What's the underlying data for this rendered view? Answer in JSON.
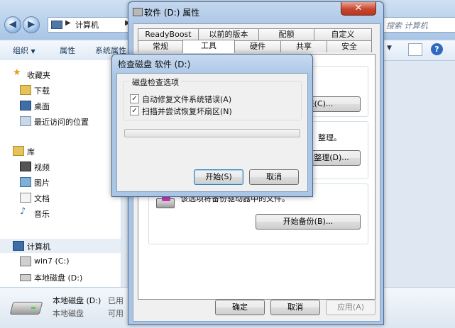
{
  "explorer": {
    "address_root": "计算机",
    "search_placeholder": "搜索 计算机",
    "toolbar": {
      "organize": "组织",
      "organize_arrow": "▼",
      "properties": "属性",
      "system_properties": "系统属性"
    },
    "nav": {
      "favorites": "收藏夹",
      "downloads": "下载",
      "desktop": "桌面",
      "recent": "最近访问的位置",
      "libraries": "库",
      "videos": "视频",
      "pictures": "图片",
      "documents": "文档",
      "music": "音乐",
      "computer": "计算机",
      "drive_c": "win7 (C:)",
      "drive_d": "本地磁盘 (D:)"
    },
    "details": {
      "name": "本地磁盘 (D:)",
      "type": "本地磁盘",
      "used": "已用",
      "available": "可用"
    }
  },
  "properties_dialog": {
    "title": "软件 (D:) 属性",
    "close_glyph": "✕",
    "tabs_row1": [
      "ReadyBoost",
      "以前的版本",
      "配额",
      "自定义"
    ],
    "tabs_row2": [
      "常规",
      "工具",
      "硬件",
      "共享",
      "安全"
    ],
    "active_tab": "工具",
    "check_now_btn": "开始检查(C)...",
    "defrag_text": "整理。",
    "defrag_btn": "立即进行碎片整理(D)...",
    "backup_text": "该选项将备份驱动器中的文件。",
    "backup_btn": "开始备份(B)...",
    "ok": "确定",
    "cancel": "取消",
    "apply": "应用(A)"
  },
  "check_disk_dialog": {
    "title": "检查磁盘 软件 (D:)",
    "group_label": "磁盘检查选项",
    "option1": "自动修复文件系统错误(A)",
    "option1_checked": true,
    "option2": "扫描并尝试恢复坏扇区(N)",
    "option2_checked": true,
    "progress": 0,
    "start": "开始(S)",
    "cancel": "取消",
    "check_glyph": "✓"
  },
  "colors": {
    "progress_green": "#37b64a",
    "window_frame": "#a9c4e4"
  }
}
